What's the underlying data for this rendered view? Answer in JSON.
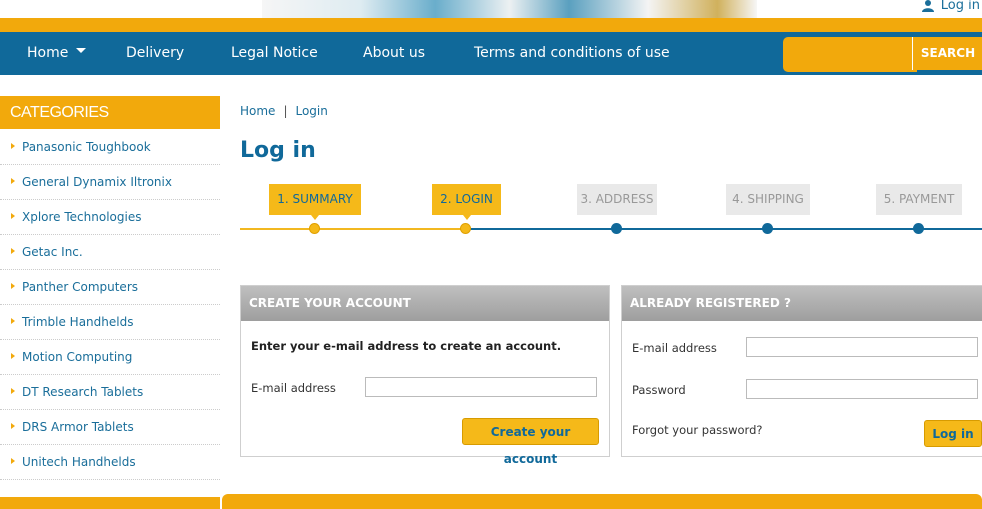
{
  "header": {
    "login_link": "Log in"
  },
  "nav": {
    "items": [
      "Home",
      "Delivery",
      "Legal Notice",
      "About us",
      "Terms and conditions of use"
    ],
    "search_button": "SEARCH"
  },
  "sidebar": {
    "title": "CATEGORIES",
    "items": [
      "Panasonic Toughbook",
      "General Dynamix Iltronix",
      "Xplore Technologies",
      "Getac Inc.",
      "Panther Computers",
      "Trimble Handhelds",
      "Motion Computing",
      "DT Research Tablets",
      "DRS Armor Tablets",
      "Unitech Handhelds"
    ]
  },
  "breadcrumb": {
    "home": "Home",
    "separator": "|",
    "current": "Login"
  },
  "page_title": "Log in",
  "steps": [
    {
      "label": "1. SUMMARY",
      "state": "done"
    },
    {
      "label": "2. LOGIN",
      "state": "done"
    },
    {
      "label": "3. ADDRESS",
      "state": "todo"
    },
    {
      "label": "4. SHIPPING",
      "state": "todo"
    },
    {
      "label": "5. PAYMENT",
      "state": "todo"
    }
  ],
  "create_account": {
    "title": "CREATE YOUR ACCOUNT",
    "intro": "Enter your e-mail address to create an account.",
    "email_label": "E-mail address",
    "email_value": "",
    "button": "Create your account"
  },
  "registered": {
    "title": "ALREADY REGISTERED ?",
    "email_label": "E-mail address",
    "email_value": "",
    "password_label": "Password",
    "password_value": "",
    "forgot": "Forgot your password?",
    "button": "Log in"
  },
  "colors": {
    "brand_blue": "#10699a",
    "accent_orange": "#f2a90c",
    "step_done": "#f5b919"
  },
  "icons": {
    "user": "user-icon",
    "caret": "chevron-down-icon"
  }
}
